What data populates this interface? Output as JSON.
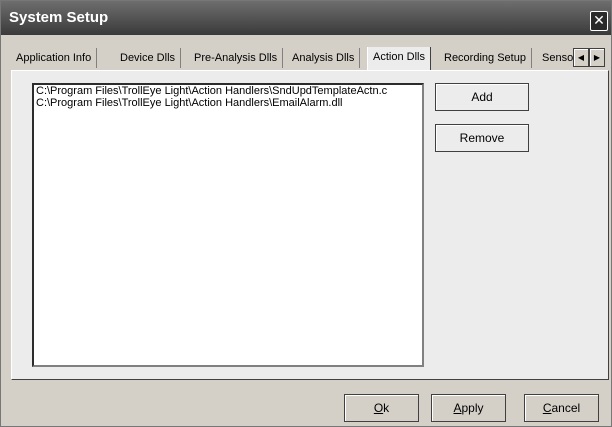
{
  "window": {
    "title": "System Setup",
    "close_glyph": "✕"
  },
  "tabs": [
    {
      "label": "Application Info"
    },
    {
      "label": "Device Dlls"
    },
    {
      "label": "Pre-Analysis Dlls"
    },
    {
      "label": "Analysis Dlls"
    },
    {
      "label": "Action Dlls",
      "active": true
    },
    {
      "label": "Recording Setup"
    },
    {
      "label": "Senso"
    }
  ],
  "tab_scroll": {
    "left_glyph": "◀",
    "right_glyph": "▶"
  },
  "action_dlls": {
    "items": [
      "C:\\Program Files\\TrollEye Light\\Action Handlers\\SndUpdTemplateActn.c",
      "C:\\Program Files\\TrollEye Light\\Action Handlers\\EmailAlarm.dll"
    ],
    "add_label": "Add",
    "remove_label": "Remove"
  },
  "footer": {
    "ok_first": "O",
    "ok_rest": "k",
    "apply_first": "A",
    "apply_rest": "pply",
    "cancel_first": "C",
    "cancel_rest": "ancel"
  }
}
